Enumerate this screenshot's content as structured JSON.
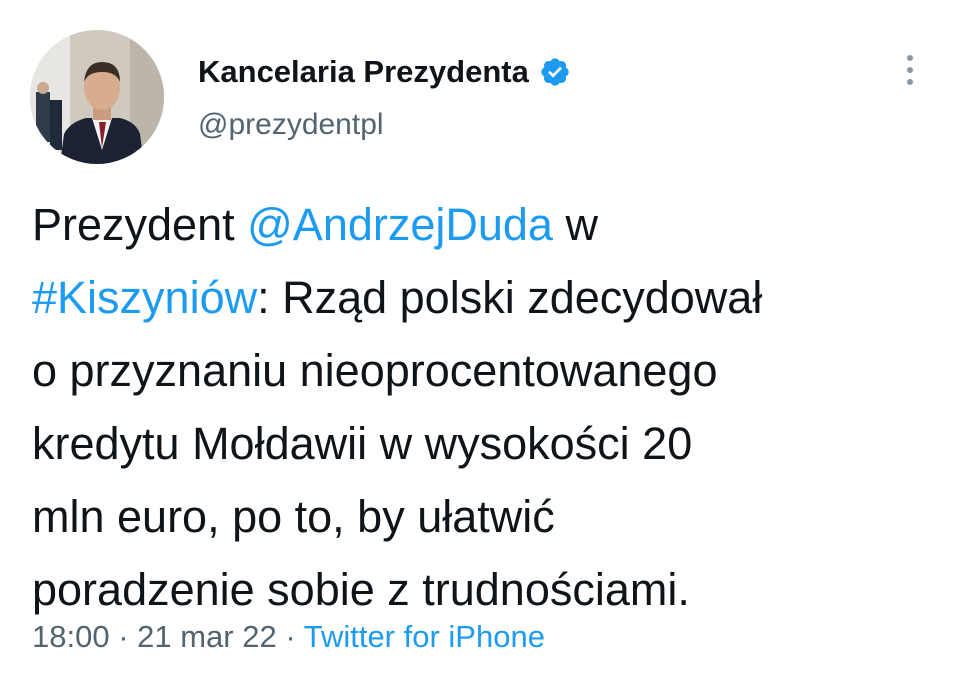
{
  "account": {
    "display_name": "Kancelaria Prezydenta",
    "handle": "@prezydentpl",
    "verified_icon": "verified-badge-icon",
    "more_icon": "more-vertical-icon"
  },
  "tweet": {
    "line1_a": "Prezydent ",
    "mention": "@AndrzejDuda",
    "line1_b": " w",
    "hashtag": "#Kiszyniów",
    "line2_rest": ": Rząd polski zdecydował",
    "line3": "o przyznaniu nieoprocentowanego",
    "line4": "kredytu Mołdawii w wysokości 20",
    "line5": "mln euro, po to, by ułatwić",
    "line6": "poradzenie sobie z trudnościami."
  },
  "meta": {
    "time": "18:00",
    "sep1": " · ",
    "date": "21 mar 22",
    "sep2": " · ",
    "source": "Twitter for iPhone"
  },
  "colors": {
    "link": "#1d9bf0",
    "secondary_text": "#536471",
    "primary_text": "#0f1419"
  }
}
